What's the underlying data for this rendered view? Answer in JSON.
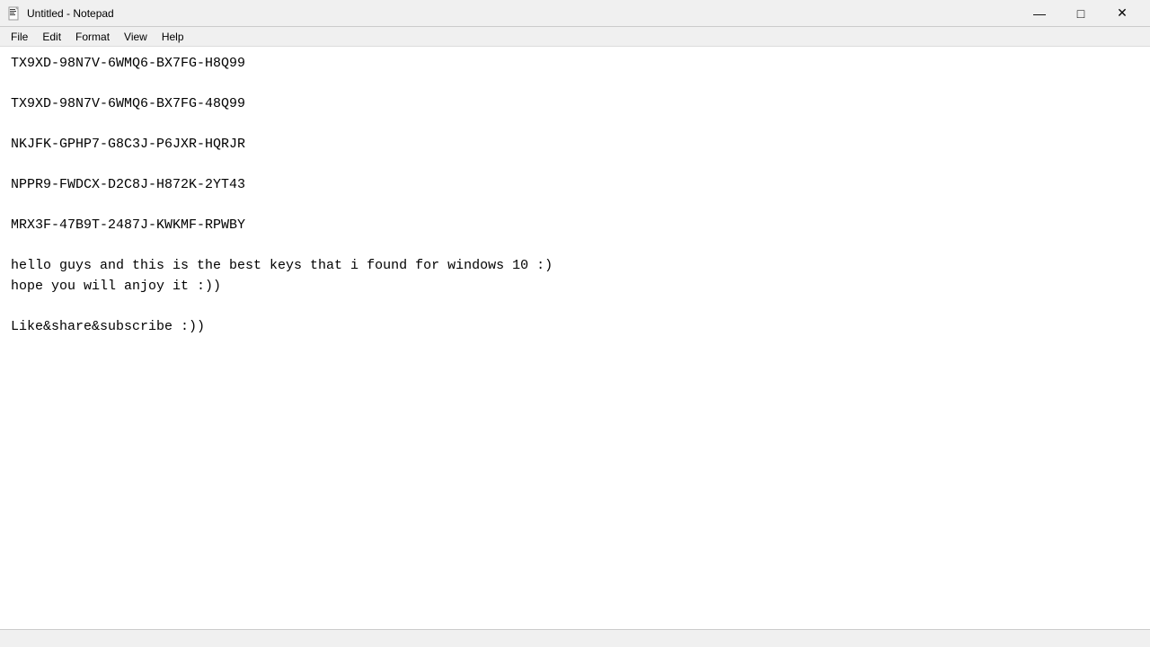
{
  "window": {
    "title": "Untitled - Notepad",
    "icon": "notepad-icon"
  },
  "titlebar": {
    "minimize_label": "—",
    "maximize_label": "□",
    "close_label": "✕"
  },
  "menubar": {
    "items": [
      {
        "id": "file",
        "label": "File"
      },
      {
        "id": "edit",
        "label": "Edit"
      },
      {
        "id": "format",
        "label": "Format"
      },
      {
        "id": "view",
        "label": "View"
      },
      {
        "id": "help",
        "label": "Help"
      }
    ]
  },
  "editor": {
    "content": "TX9XD-98N7V-6WMQ6-BX7FG-H8Q99\n\nTX9XD-98N7V-6WMQ6-BX7FG-48Q99\n\nNKJFK-GPHP7-G8C3J-P6JXR-HQRJR\n\nNPPR9-FWDCX-D2C8J-H872K-2YT43\n\nMRX3F-47B9T-2487J-KWKMF-RPWBY\n\nhello guys and this is the best keys that i found for windows 10 :)\nhope you will anjoy it :))\n\nLike&share&subscribe :))"
  }
}
